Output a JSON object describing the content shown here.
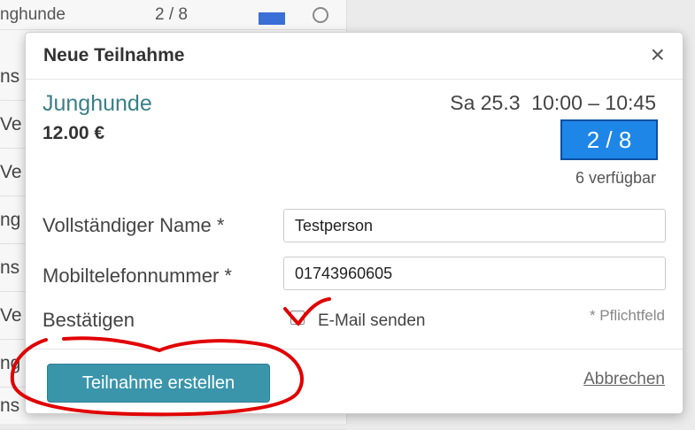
{
  "background_list": {
    "top_row": {
      "text": "nghunde",
      "count": "2 / 8"
    },
    "rows": [
      "ns",
      "Ve",
      "Ve",
      "ng",
      "ns",
      "Ve",
      "ng",
      "ns"
    ]
  },
  "modal": {
    "title": "Neue Teilnahme",
    "close_symbol": "×",
    "event": {
      "name": "Junghunde",
      "price": "12.00 €",
      "datetime": "Sa 25.3  10:00 – 10:45",
      "capacity": "2 / 8",
      "available": "6 verfügbar"
    },
    "form": {
      "name_label": "Vollständiger Name *",
      "name_value": "Testperson",
      "phone_label": "Mobiltelefonnummer *",
      "phone_value": "01743960605",
      "confirm_label": "Bestätigen",
      "email_checkbox_label": "E-Mail senden",
      "required_note": "* Pflichtfeld"
    },
    "footer": {
      "submit_label": "Teilnahme erstellen",
      "cancel_label": "Abbrechen"
    }
  },
  "colors": {
    "accent": "#3a7f87",
    "primary_button": "#3a95ab",
    "capacity_badge": "#1e86e6",
    "annotation": "#e10000"
  },
  "icons": {
    "close": "close-icon",
    "calendar": "calendar-icon",
    "search": "search-icon"
  }
}
